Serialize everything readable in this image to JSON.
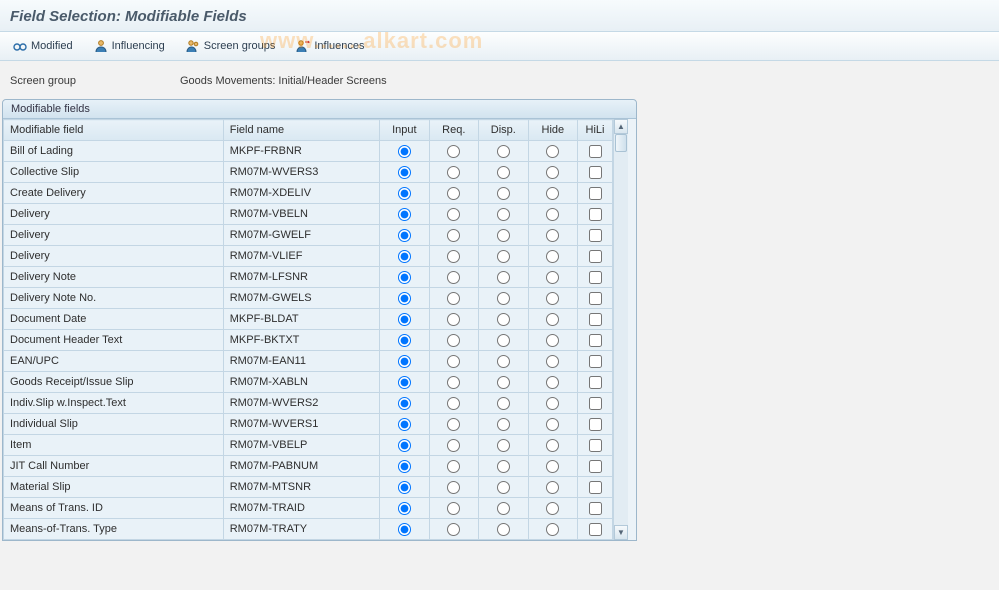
{
  "title": "Field Selection: Modifiable Fields",
  "toolbar": {
    "modified": "Modified",
    "influencing": "Influencing",
    "screen_groups": "Screen groups",
    "influences": "Influences"
  },
  "info": {
    "label": "Screen group",
    "value": "Goods Movements: Initial/Header Screens"
  },
  "panel": {
    "title": "Modifiable fields"
  },
  "columns": {
    "field": "Modifiable field",
    "name": "Field name",
    "input": "Input",
    "req": "Req.",
    "disp": "Disp.",
    "hide": "Hide",
    "hili": "HiLi"
  },
  "rows": [
    {
      "field": "Bill of Lading",
      "name": "MKPF-FRBNR"
    },
    {
      "field": "Collective Slip",
      "name": "RM07M-WVERS3"
    },
    {
      "field": "Create Delivery",
      "name": "RM07M-XDELIV"
    },
    {
      "field": "Delivery",
      "name": "RM07M-VBELN"
    },
    {
      "field": "Delivery",
      "name": "RM07M-GWELF"
    },
    {
      "field": "Delivery",
      "name": "RM07M-VLIEF"
    },
    {
      "field": "Delivery Note",
      "name": "RM07M-LFSNR"
    },
    {
      "field": "Delivery Note No.",
      "name": "RM07M-GWELS"
    },
    {
      "field": "Document Date",
      "name": "MKPF-BLDAT"
    },
    {
      "field": "Document Header Text",
      "name": "MKPF-BKTXT"
    },
    {
      "field": "EAN/UPC",
      "name": "RM07M-EAN11"
    },
    {
      "field": "Goods Receipt/Issue Slip",
      "name": "RM07M-XABLN"
    },
    {
      "field": "Indiv.Slip w.Inspect.Text",
      "name": "RM07M-WVERS2"
    },
    {
      "field": "Individual Slip",
      "name": "RM07M-WVERS1"
    },
    {
      "field": "Item",
      "name": "RM07M-VBELP"
    },
    {
      "field": "JIT Call Number",
      "name": "RM07M-PABNUM"
    },
    {
      "field": "Material Slip",
      "name": "RM07M-MTSNR"
    },
    {
      "field": "Means of Trans. ID",
      "name": "RM07M-TRAID"
    },
    {
      "field": "Means-of-Trans. Type",
      "name": "RM07M-TRATY"
    }
  ],
  "watermark": "www.......alkart.com"
}
